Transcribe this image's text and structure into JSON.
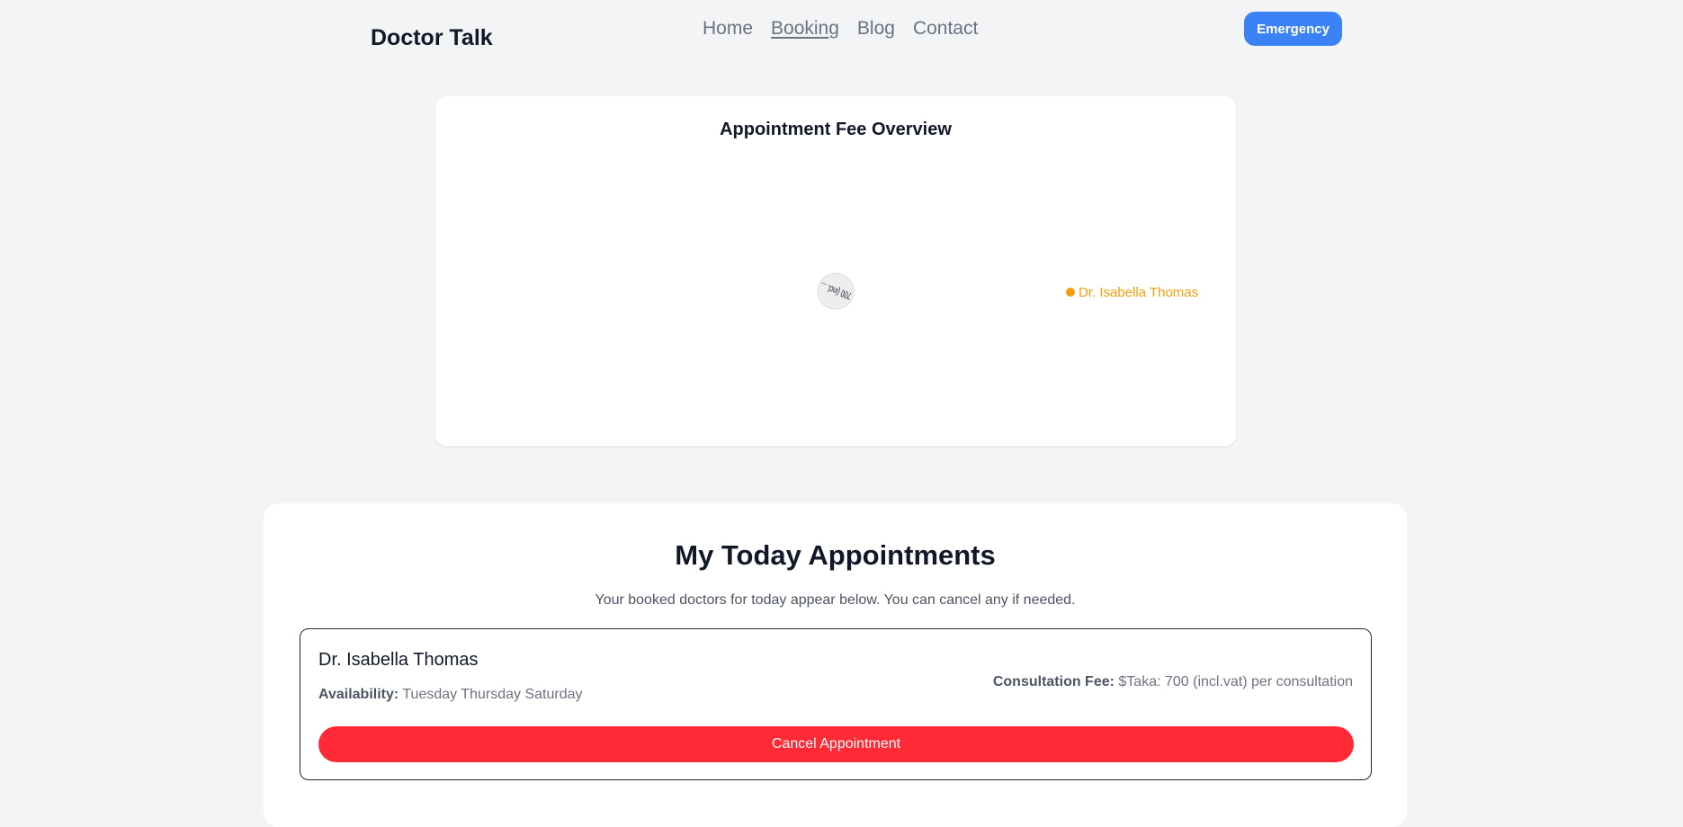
{
  "header": {
    "brand": "Doctor Talk",
    "nav": [
      {
        "label": "Home",
        "active": false
      },
      {
        "label": "Booking",
        "active": true
      },
      {
        "label": "Blog",
        "active": false
      },
      {
        "label": "Contact",
        "active": false
      }
    ],
    "emergency_label": "Emergency"
  },
  "chart_data": {
    "type": "pie",
    "title": "Appointment Fee Overview",
    "labels": [
      "Dr. Isabella Thomas"
    ],
    "values": [
      700
    ],
    "slice_label": "700 (incl. ...",
    "legend_position": "right",
    "colors": {
      "slice": "#f59e0b",
      "legend_text": "#f59e0b"
    }
  },
  "appointments": {
    "heading": "My Today Appointments",
    "subtitle": "Your booked doctors for today appear below. You can cancel any if needed.",
    "items": [
      {
        "doctor": "Dr. Isabella Thomas",
        "availability_label": "Availability:",
        "availability": "Tuesday Thursday Saturday",
        "fee_label": "Consultation Fee:",
        "fee": "$Taka: 700 (incl.vat) per consultation",
        "cancel_label": "Cancel Appointment"
      }
    ]
  },
  "colors": {
    "accent_blue": "#3b82f6",
    "danger_red": "#ff2a36",
    "background": "#f3f4f6"
  }
}
